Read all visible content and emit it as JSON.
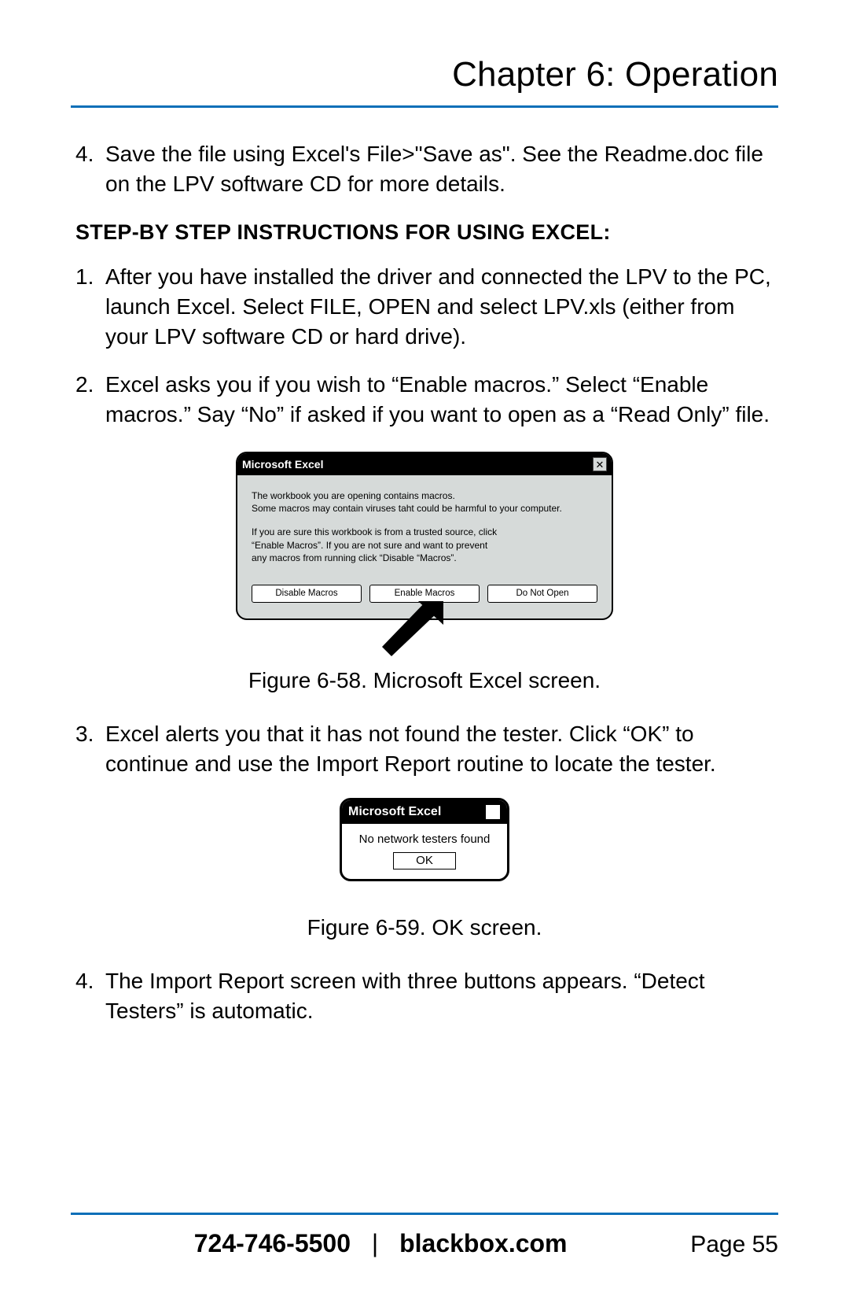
{
  "header": {
    "chapter": "Chapter 6: Operation"
  },
  "intro4": {
    "num": "4.",
    "text": "Save the file using Excel's File>\"Save as\". See the Readme.doc file on the LPV software CD for more details."
  },
  "step_heading": "STEP-BY STEP INSTRUCTIONS FOR USING EXCEL:",
  "steps": {
    "s1": {
      "num": "1.",
      "text": "After you have installed the driver and connected the LPV to the PC, launch Excel. Select FILE, OPEN and select LPV.xls (either from your LPV software CD or hard drive)."
    },
    "s2": {
      "num": "2.",
      "text": "Excel asks you if you wish to “Enable macros.” Select “Enable macros.” Say “No” if asked if you want to open as a “Read Only” file."
    },
    "s3": {
      "num": "3.",
      "text": "Excel alerts you that it has not found the tester. Click “OK” to continue and use the Import Report routine to locate the tester."
    },
    "s4": {
      "num": "4.",
      "text": "The Import Report screen with three buttons appears. “Detect Testers” is automatic."
    }
  },
  "dialog1": {
    "title": "Microsoft Excel",
    "close_glyph": "✕",
    "line1": "The workbook you are opening contains macros.",
    "line2": "Some macros may contain viruses taht could be harmful to your computer.",
    "line3": "If you are sure this workbook is from a trusted source, click",
    "line4": "“Enable Macros”. If you are not sure and want to prevent",
    "line5": "any macros from running click “Disable “Macros”.",
    "btn_disable": "Disable Macros",
    "btn_enable": "Enable Macros",
    "btn_donotopen": "Do Not Open"
  },
  "caption1": "Figure 6-58. Microsoft Excel screen.",
  "dialog2": {
    "title": "Microsoft Excel",
    "close_glyph": "✕",
    "message": "No network testers found",
    "ok": "OK"
  },
  "caption2": "Figure 6-59. OK screen.",
  "footer": {
    "phone": "724-746-5500",
    "sep": "|",
    "site": "blackbox.com",
    "page": "Page 55"
  }
}
